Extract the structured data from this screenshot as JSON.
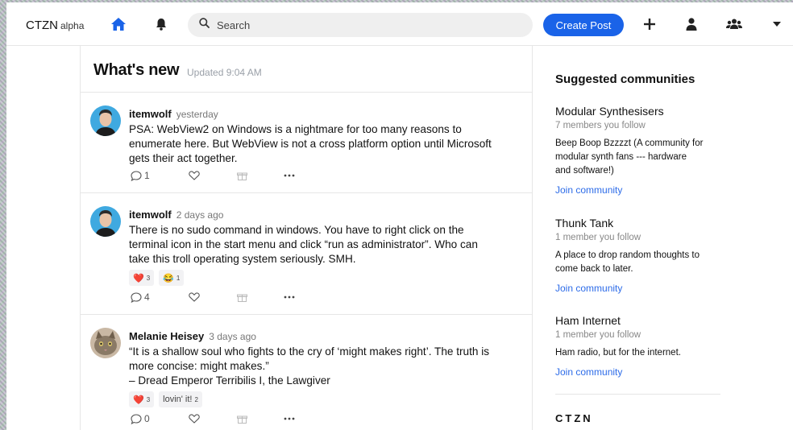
{
  "header": {
    "brand": "CTZN",
    "brand_suffix": "alpha",
    "search_placeholder": "Search",
    "create_post_label": "Create Post",
    "accent": "#1a63e8"
  },
  "feed": {
    "title": "What's new",
    "updated": "Updated 9:04 AM",
    "posts": [
      {
        "author": "itemwolf",
        "time": "yesterday",
        "text": "PSA: WebView2 on Windows is a nightmare for too many reasons to\nenumerate here. But WebView is not a cross platform option until Microsoft\ngets their act together.",
        "reply_count": "1",
        "reactions": []
      },
      {
        "author": "itemwolf",
        "time": "2 days ago",
        "text": "There is no sudo command in windows. You have to right click on the\nterminal icon in the start menu and click “run as administrator”. Who can\ntake this troll operating system seriously. SMH.",
        "reply_count": "4",
        "reactions": [
          {
            "emoji": "❤️",
            "count": "3"
          },
          {
            "emoji": "😂",
            "count": "1"
          }
        ]
      },
      {
        "author": "Melanie Heisey",
        "time": "3 days ago",
        "text": "“It is a shallow soul who fights to the cry of ‘might makes right’. The truth is\nmore concise: might makes.”\n– Dread Emperor Terribilis I, the Lawgiver",
        "reply_count": "0",
        "reactions": [
          {
            "emoji": "❤️",
            "count": "3"
          },
          {
            "emoji": "lovin' it!",
            "count": "2"
          }
        ]
      }
    ]
  },
  "sidebar": {
    "title": "Suggested communities",
    "communities": [
      {
        "name": "Modular Synthesisers",
        "follow": "7 members you follow",
        "desc": "Beep Boop Bzzzzt (A community for\nmodular synth fans --- hardware\nand software!)",
        "join": "Join community"
      },
      {
        "name": "Thunk Tank",
        "follow": "1 member you follow",
        "desc": "A place to drop random thoughts to\ncome back to later.",
        "join": "Join community"
      },
      {
        "name": "Ham Internet",
        "follow": "1 member you follow",
        "desc": "Ham radio, but for the internet.",
        "join": "Join community"
      }
    ],
    "footer_logo": "CTZN"
  }
}
